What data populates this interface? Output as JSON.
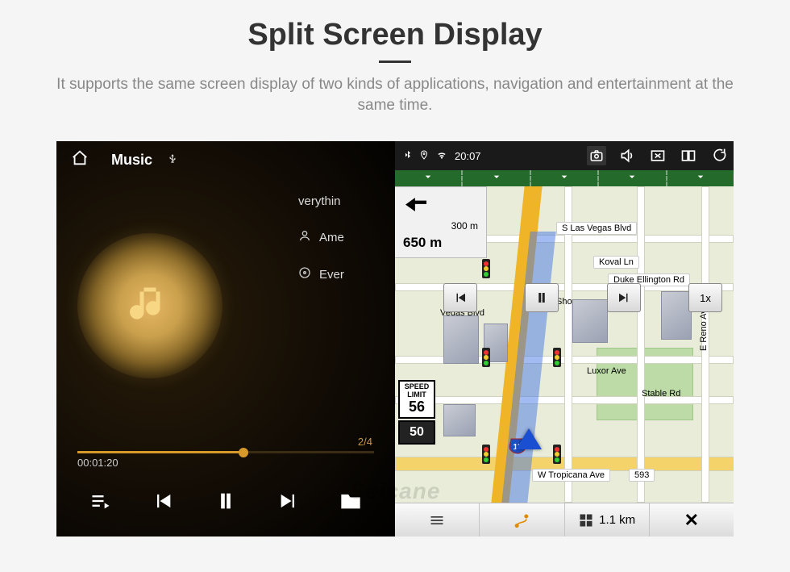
{
  "header": {
    "title": "Split Screen Display",
    "subtitle": "It supports the same screen display of two kinds of applications, navigation and entertainment at the same time."
  },
  "music": {
    "app_label": "Music",
    "track_title": "verythin",
    "artist": "Ame",
    "album": "Ever",
    "counter": "2/4",
    "elapsed": "00:01:20"
  },
  "status": {
    "time": "20:07"
  },
  "map": {
    "guide_small": "300 m",
    "guide_big": "650 m",
    "speed_limit_label": "SPEED LIMIT",
    "speed_limit": "56",
    "current_speed": "50",
    "hwy_shield": "15",
    "labels": {
      "slv": "S Las Vegas Blvd",
      "koval": "Koval Ln",
      "duke": "Duke Ellington Rd",
      "vegas": "Vegas Blvd",
      "showcs": "Showcs",
      "luxor": "Luxor Ave",
      "stable": "Stable Rd",
      "reno": "E Reno Ave",
      "trop": "W Tropicana Ave",
      "trop_num": "593"
    },
    "sim_speed": "1x"
  },
  "bottom": {
    "distance": "1.1 km"
  },
  "watermark": "Seicane"
}
